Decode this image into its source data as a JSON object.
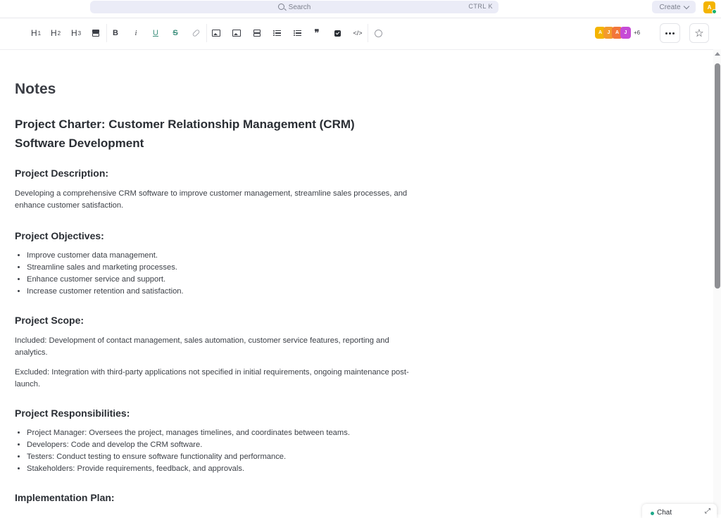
{
  "topbar": {
    "search_placeholder": "Search",
    "search_shortcut": "CTRL K",
    "create_label": "Create",
    "user_initial": "A"
  },
  "toolbar": {
    "h1": "H",
    "h2": "H",
    "h3": "H",
    "h1_num": "1",
    "h2_num": "2",
    "h3_num": "3",
    "bold": "B",
    "italic": "i",
    "underline": "U",
    "strike": "S",
    "code_icon": "</>",
    "quote_icon": "❞"
  },
  "collaborators": {
    "avatars": [
      {
        "initial": "A",
        "color": "#f4b400"
      },
      {
        "initial": "J",
        "color": "#f08a3c"
      },
      {
        "initial": "A",
        "color": "#f2763a"
      },
      {
        "initial": "J",
        "color": "#c64bd6"
      }
    ],
    "more": "+6"
  },
  "document": {
    "title": "Notes",
    "heading_line1": "Project Charter: Customer Relationship Management (CRM)",
    "heading_line2": "Software Development",
    "sections": {
      "description": {
        "heading": "Project Description:",
        "text": "Developing a comprehensive CRM software to improve customer management, streamline sales processes, and enhance customer satisfaction."
      },
      "objectives": {
        "heading": "Project Objectives:",
        "items": [
          "Improve customer data management.",
          "Streamline sales and marketing processes.",
          "Enhance customer service and support.",
          "Increase customer retention and satisfaction."
        ]
      },
      "scope": {
        "heading": "Project Scope:",
        "included": "Included: Development of contact management, sales automation, customer service features, reporting and analytics.",
        "excluded": "Excluded: Integration with third-party applications not specified in initial requirements, ongoing maintenance post-launch."
      },
      "responsibilities": {
        "heading": "Project Responsibilities:",
        "items": [
          "Project Manager: Oversees the project, manages timelines, and coordinates between teams.",
          "Developers: Code and develop the CRM software.",
          "Testers: Conduct testing to ensure software functionality and performance.",
          "Stakeholders: Provide requirements, feedback, and approvals."
        ]
      },
      "implementation": {
        "heading": "Implementation Plan:"
      }
    }
  },
  "chat": {
    "label": "Chat",
    "expand_icon": "⤢"
  }
}
